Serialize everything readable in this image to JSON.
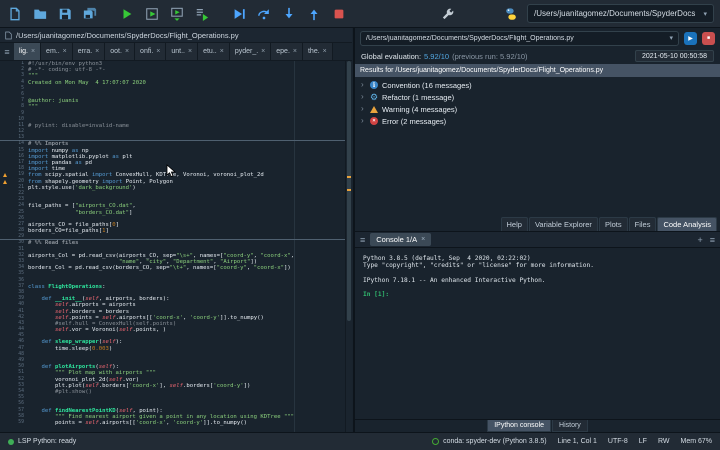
{
  "toolbar": {
    "path_selector": "/Users/juanitagomez/Documents/SpyderDocs",
    "buttons": [
      {
        "name": "new-file",
        "icon": "new-file"
      },
      {
        "name": "open-file",
        "icon": "open-folder"
      },
      {
        "name": "save-file",
        "icon": "save"
      },
      {
        "name": "save-all",
        "icon": "save-all"
      },
      {
        "name": "run-file",
        "icon": "run",
        "gap": "gap"
      },
      {
        "name": "run-cell",
        "icon": "run-cell"
      },
      {
        "name": "run-cell-advance",
        "icon": "run-cell-advance"
      },
      {
        "name": "run-selection",
        "icon": "run-selection"
      },
      {
        "name": "debug-file",
        "icon": "debug",
        "gap": "gap"
      },
      {
        "name": "step-over",
        "icon": "step-over"
      },
      {
        "name": "step-into",
        "icon": "step-into"
      },
      {
        "name": "step-return",
        "icon": "step-return"
      },
      {
        "name": "stop-debug",
        "icon": "stop"
      },
      {
        "name": "preferences",
        "icon": "wrench",
        "gap": "far"
      },
      {
        "name": "python-environment",
        "icon": "python",
        "gap": "far2"
      }
    ]
  },
  "editor": {
    "breadcrumb": "/Users/juanitagomez/Documents/SpyderDocs/Flight_Operations.py",
    "tabs": [
      "lig.",
      "em..",
      "erra.",
      "oot.",
      "onfi.",
      "unt..",
      "etu..",
      "pyder_.",
      "epe.",
      "the."
    ],
    "selected_tab_index": 0,
    "cell_lines": [
      14,
      30
    ],
    "warning_lines": [
      19,
      20
    ],
    "code_lines": [
      "#!/usr/bin/env python3",
      "# -*- coding: utf-8 -*-",
      "\"\"\"",
      "Created on Mon May  4 17:07:07 2020",
      "",
      "",
      "@author: juanis",
      "\"\"\"",
      "",
      "",
      "# pylint: disable=invalid-name",
      "",
      "",
      "# %% Imports",
      "import numpy as np",
      "import matplotlib.pyplot as plt",
      "import pandas as pd",
      "import time",
      "from scipy.spatial import ConvexHull, KDTree, Voronoi, voronoi_plot_2d",
      "from shapely.geometry import Point, Polygon",
      "plt.style.use('dark_background')",
      "",
      "",
      "file_paths = [\"airports_CO.dat\",",
      "              \"borders_CO.dat\"]",
      "",
      "airports_CO = file_paths[0]",
      "borders_CO=file_paths[1]",
      "",
      "# %% Read files",
      "",
      "airports_Col = pd.read_csv(airports_CO, sep=\"\\s+\", names=[\"coord-y\", \"coord-x\",",
      "                           \"name\", \"city\", \"Department\", \"Airport\"])",
      "borders_Col = pd.read_csv(borders_CO, sep=\"\\t+\", names=[\"coord-y\", \"coord-x\"])",
      "",
      "",
      "class FlightOperations:",
      "",
      "    def __init__(self, airports, borders):",
      "        self.airports = airports",
      "        self.borders = borders",
      "        self.points = self.airports[['coord-x', 'coord-y']].to_numpy()",
      "        #self.hull = ConvexHull(self.points)",
      "        self.vor = Voronoi(self.points, )",
      "",
      "    def sleep_wrapper(self):",
      "        time.sleep(0.003)",
      "",
      "",
      "    def plotAirports(self):",
      "        \"\"\" Plot map with airports \"\"\"",
      "        voronoi_plot_2d(self.vor)",
      "        plt.plot(self.borders['coord-x'], self.borders['coord-y'])",
      "        #plt.show()",
      "",
      "",
      "    def findNearestPointKD(self, point):",
      "        \"\"\" Find nearest airport given a point in any location using KDTree \"\"\"",
      "        points = self.airports[['coord-x', 'coord-y']].to_numpy()"
    ]
  },
  "analysis": {
    "path": "/Users/juanitagomez/Documents/SpyderDocs/Flight_Operations.py",
    "eval_label": "Global evaluation:",
    "score": "5.92/10",
    "previous": "(previous run: 5.92/10)",
    "timestamp": "2021-05-10 00:50:58",
    "results_header": "Results for /Users/juanitagomez/Documents/SpyderDocs/Flight_Operations.py",
    "categories": [
      {
        "type": "convention",
        "label": "Convention (16 messages)"
      },
      {
        "type": "refactor",
        "label": "Refactor (1 message)"
      },
      {
        "type": "warning",
        "label": "Warning (4 messages)"
      },
      {
        "type": "error",
        "label": "Error (2 messages)"
      }
    ]
  },
  "pane_tabs": [
    "Help",
    "Variable Explorer",
    "Plots",
    "Files",
    "Code Analysis"
  ],
  "pane_tabs_selected": "Code Analysis",
  "console": {
    "tab": "Console 1/A",
    "lines": [
      "Python 3.8.5 (default, Sep  4 2020, 02:22:02)",
      "Type \"copyright\", \"credits\" or \"license\" for more information.",
      "",
      "IPython 7.18.1 -- An enhanced Interactive Python.",
      "",
      "In [1]:"
    ],
    "bottom_tabs": [
      "IPython console",
      "History"
    ],
    "bottom_tabs_selected": "IPython console"
  },
  "statusbar": {
    "lsp": "LSP Python: ready",
    "env": "conda: spyder-dev (Python 3.8.5)",
    "cursor": "Line 1, Col 1",
    "encoding": "UTF-8",
    "eol": "LF",
    "permissions": "RW",
    "memory": "Mem 67%"
  },
  "colors": {
    "accent": "#1a72bb",
    "warning": "#e8a33d",
    "error": "#d14343",
    "score": "#53a8e2",
    "string": "#8cd17d",
    "keyword": "#559cd5"
  }
}
